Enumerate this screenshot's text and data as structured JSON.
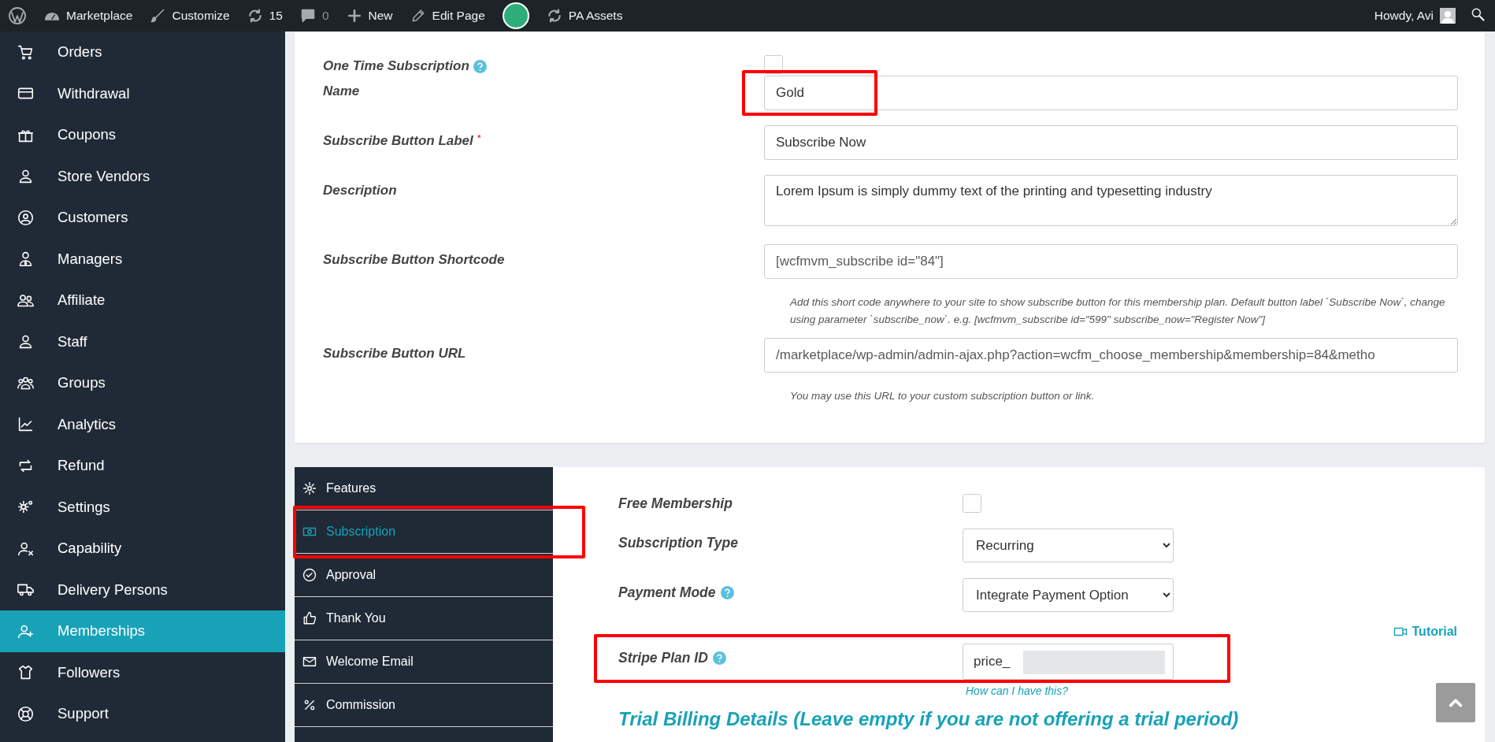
{
  "top_bar": {
    "items": [
      {
        "kind": "dashboard",
        "label": "Marketplace"
      },
      {
        "kind": "customize",
        "label": "Customize"
      },
      {
        "kind": "updates",
        "label": "15"
      },
      {
        "kind": "comments",
        "label": "0"
      },
      {
        "kind": "new",
        "label": "New"
      },
      {
        "kind": "edit",
        "label": "Edit Page"
      },
      {
        "kind": "store"
      },
      {
        "kind": "sync",
        "label": "PA Assets"
      }
    ],
    "greeting": "Howdy, Avi"
  },
  "sidebar": {
    "items": [
      {
        "label": "Orders",
        "selected": false
      },
      {
        "label": "Withdrawal",
        "selected": false
      },
      {
        "label": "Coupons",
        "selected": false
      },
      {
        "label": "Store Vendors",
        "selected": false
      },
      {
        "label": "Customers",
        "selected": false
      },
      {
        "label": "Managers",
        "selected": false
      },
      {
        "label": "Affiliate",
        "selected": false
      },
      {
        "label": "Staff",
        "selected": false
      },
      {
        "label": "Groups",
        "selected": false
      },
      {
        "label": "Analytics",
        "selected": false
      },
      {
        "label": "Refund",
        "selected": false
      },
      {
        "label": "Settings",
        "selected": false
      },
      {
        "label": "Capability",
        "selected": false
      },
      {
        "label": "Delivery Persons",
        "selected": false
      },
      {
        "label": "Memberships",
        "selected": true
      },
      {
        "label": "Followers",
        "selected": false
      },
      {
        "label": "Support",
        "selected": false
      }
    ]
  },
  "plan_form": {
    "fields": [
      {
        "kind": "checkbox",
        "label": "One Time Subscription",
        "help": true,
        "checked": false
      },
      {
        "kind": "text",
        "label": "Name",
        "value": "Gold",
        "highlighted": true
      },
      {
        "kind": "text",
        "label": "Subscribe Button Label",
        "required": "*",
        "value": "Subscribe Now"
      },
      {
        "kind": "textarea",
        "label": "Description",
        "value": "Lorem Ipsum is simply dummy text of the printing and typesetting industry"
      },
      {
        "kind": "readonly",
        "label": "Subscribe Button Shortcode",
        "value": "[wcfmvm_subscribe id=\"84\"]",
        "note": "Add this short code anywhere to your site to show subscribe button for this membership plan. Default button label `Subscribe Now`, change using parameter `subscribe_now`. e.g. [wcfmvm_subscribe id=\"599\" subscribe_now=\"Register Now\"]"
      },
      {
        "kind": "readonly",
        "label": "Subscribe Button URL",
        "value": "/marketplace/wp-admin/admin-ajax.php?action=wcfm_choose_membership&membership=84&metho",
        "note": "You may use this URL to your custom subscription button or link."
      }
    ]
  },
  "settings_tabs": [
    {
      "label": "Features",
      "selected": false,
      "highlighted": false
    },
    {
      "label": "Subscription",
      "selected": true,
      "highlighted": true
    },
    {
      "label": "Approval",
      "selected": false,
      "highlighted": false
    },
    {
      "label": "Thank You",
      "selected": false,
      "highlighted": false
    },
    {
      "label": "Welcome Email",
      "selected": false,
      "highlighted": false
    },
    {
      "label": "Commission",
      "selected": false,
      "highlighted": false
    }
  ],
  "subscription_panel": {
    "fields": [
      {
        "kind": "checkbox",
        "label": "Free Membership",
        "checked": false
      },
      {
        "kind": "select",
        "label": "Subscription Type",
        "value": "Recurring"
      },
      {
        "kind": "select",
        "label": "Payment Mode",
        "help": true,
        "value": "Integrate Payment Option"
      },
      {
        "kind": "text",
        "label": "Stripe Plan ID",
        "help": true,
        "value": "price_",
        "redacted": true,
        "highlighted": true,
        "tutorial": "Tutorial",
        "link": "How can I have this?"
      }
    ],
    "heading": "Trial Billing Details (Leave empty if you are not offering a trial period)"
  }
}
